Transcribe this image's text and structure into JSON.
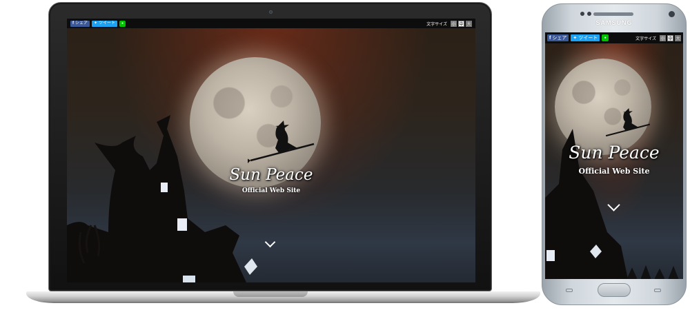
{
  "share": {
    "facebook_label": "シェア",
    "twitter_label": "ツイート",
    "line_label": "LINE",
    "facebook_icon": "facebook-icon",
    "twitter_icon": "twitter-icon"
  },
  "font_size": {
    "label": "文字サイズ",
    "small": "小",
    "medium": "中",
    "large": "大"
  },
  "hero": {
    "title": "Sun Peace",
    "subtitle": "Official Web Site",
    "scroll_icon": "chevron-down-icon"
  },
  "phone": {
    "brand": "SAMSUNG"
  },
  "colors": {
    "facebook": "#3b5998",
    "twitter": "#1da1f2",
    "line": "#00c300",
    "toolbar": "#0d0d0d"
  }
}
